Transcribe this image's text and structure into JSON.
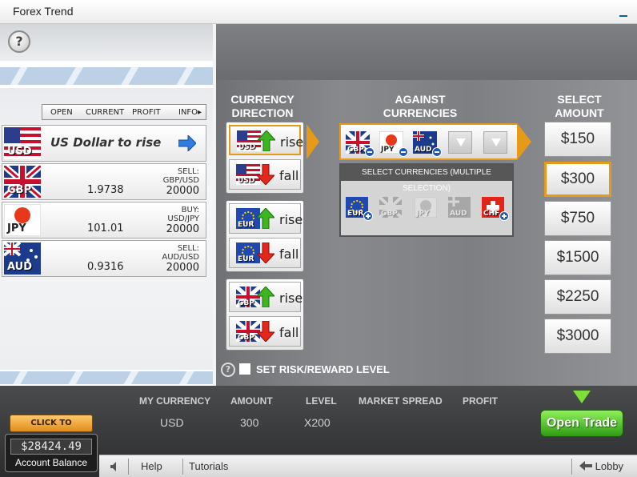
{
  "window": {
    "title": "Forex Trend"
  },
  "left_panel": {
    "columns": [
      "OPEN",
      "CURRENT",
      "PROFIT",
      "INFO▸"
    ],
    "base": {
      "code": "USD",
      "label": "US Dollar to rise"
    },
    "rows": [
      {
        "code": "GBP",
        "current": "1.9738",
        "info_line1": "SELL:",
        "info_line2": "GBP/USD",
        "amount": "20000"
      },
      {
        "code": "JPY",
        "current": "101.01",
        "info_line1": "BUY:",
        "info_line2": "USD/JPY",
        "amount": "20000"
      },
      {
        "code": "AUD",
        "current": "0.9316",
        "info_line1": "SELL:",
        "info_line2": "AUD/USD",
        "amount": "20000"
      }
    ]
  },
  "direction": {
    "title_line1": "CURRENCY",
    "title_line2": "DIRECTION",
    "buttons": [
      {
        "code": "USD",
        "word": "rise"
      },
      {
        "code": "USD",
        "word": "fall"
      },
      {
        "code": "EUR",
        "word": "rise"
      },
      {
        "code": "EUR",
        "word": "fall"
      },
      {
        "code": "GBP",
        "word": "rise"
      },
      {
        "code": "GBP",
        "word": "fall"
      }
    ]
  },
  "against": {
    "title_line1": "AGAINST",
    "title_line2": "CURRENCIES",
    "selected": [
      "GBP",
      "JPY",
      "AUD"
    ],
    "select_header": "SELECT CURRENCIES (MULTIPLE SELECTION)",
    "available": [
      "EUR",
      "GBP",
      "JPY",
      "AUD",
      "CHF"
    ]
  },
  "amount": {
    "title_line1": "SELECT",
    "title_line2": "AMOUNT",
    "options": [
      "$150",
      "$300",
      "$750",
      "$1500",
      "$2250",
      "$3000"
    ],
    "selected": "$300"
  },
  "risk": {
    "label": "SET RISK/REWARD LEVEL",
    "q": "?"
  },
  "trade_info": {
    "headers": [
      "MY CURRENCY",
      "AMOUNT",
      "LEVEL",
      "MARKET SPREAD",
      "PROFIT"
    ],
    "values": [
      "USD",
      "300",
      "X200",
      "",
      ""
    ]
  },
  "deposit_label": "CLICK TO DEPOSIT",
  "balance": {
    "value": "$28424.49",
    "label": "Account Balance"
  },
  "open_trade_label": "Open Trade",
  "statusbar": {
    "help": "Help",
    "tutorials": "Tutorials",
    "lobby": "Lobby"
  },
  "help_q": "?"
}
